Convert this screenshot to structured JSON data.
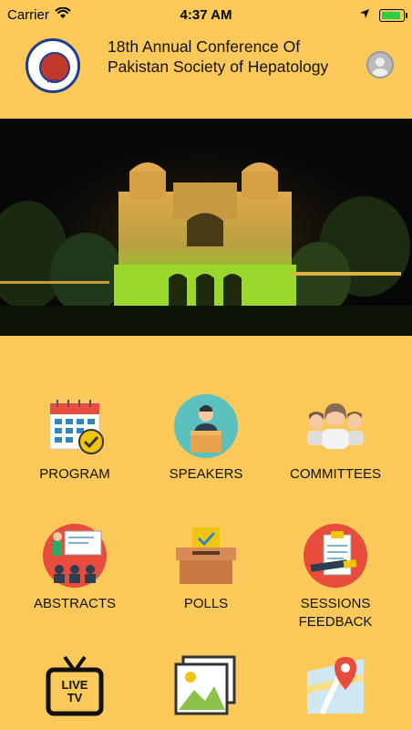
{
  "status": {
    "carrier": "Carrier",
    "time": "4:37 AM"
  },
  "header": {
    "title": "18th Annual Conference Of Pakistan Society of Hepatology",
    "logo_text": "PSH"
  },
  "menu": {
    "program": "PROGRAM",
    "speakers": "SPEAKERS",
    "committees": "COMMITTEES",
    "abstracts": "ABSTRACTS",
    "polls": "POLLS",
    "sessions_feedback": "SESSIONS\nFEEDBACK",
    "live_tv_icon_text": "LIVE\nTV"
  },
  "colors": {
    "background": "#FAC95A",
    "logo_ring": "#1f3d8f"
  }
}
